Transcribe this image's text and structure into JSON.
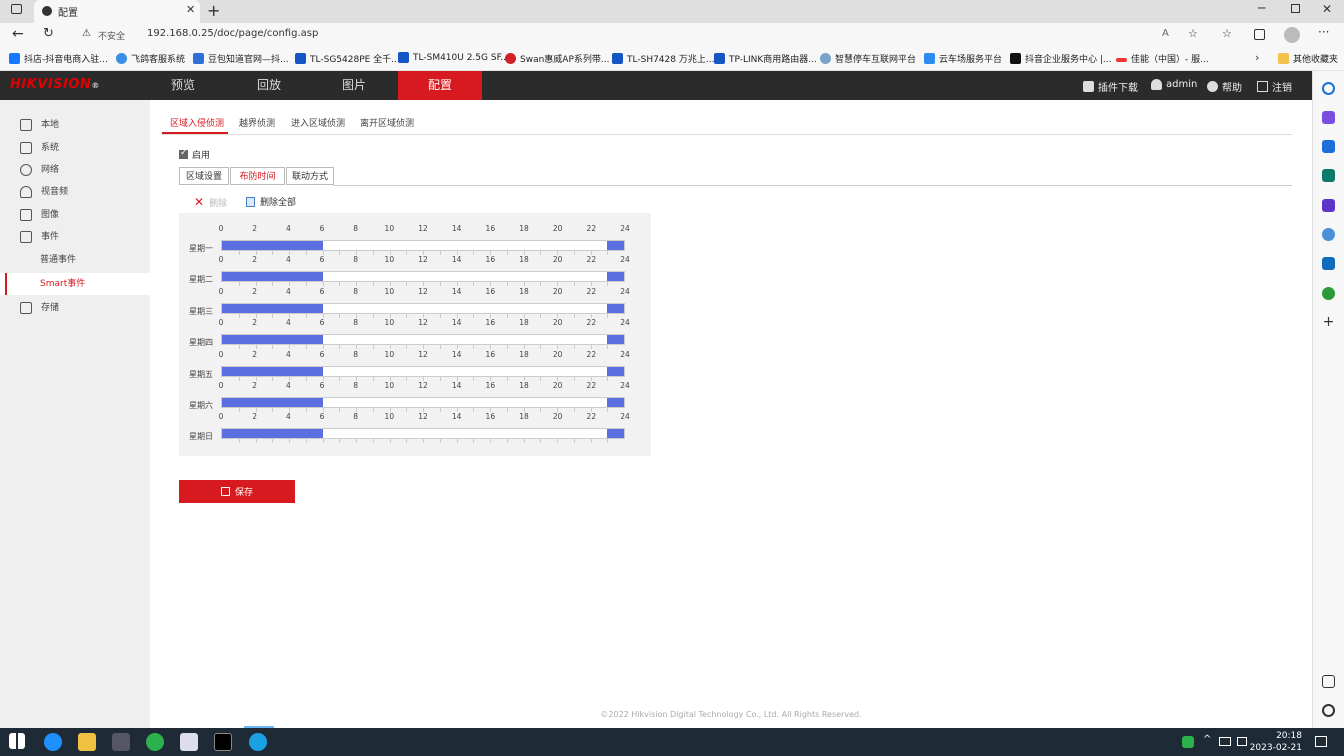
{
  "browser": {
    "tab_title": "配置",
    "security_label": "不安全",
    "url": "192.168.0.25/doc/page/config.asp",
    "bookmarks": [
      "抖店-抖音电商入驻...",
      "飞鸽客服系统",
      "豆包知道官网—抖...",
      "TL-SG5428PE 全千...",
      "TL-SM410U 2.5G SF...",
      "Swan惠威AP系列带...",
      "TL-SH7428 万兆上...",
      "TP-LINK商用路由器...",
      "智慧停车互联网平台",
      "云车场服务平台",
      "抖音企业服务中心 |...",
      "佳能（中国）- 服...",
      "其他收藏夹"
    ]
  },
  "header": {
    "brand": "HIKVISION",
    "nav": [
      "预览",
      "回放",
      "图片",
      "配置"
    ],
    "active_nav": "配置",
    "plugin_label": "插件下载",
    "user_label": "admin",
    "help_label": "帮助",
    "logout_label": "注销"
  },
  "sidebar": {
    "items": [
      {
        "label": "本地",
        "icon": "monitor-icon"
      },
      {
        "label": "系统",
        "icon": "system-icon"
      },
      {
        "label": "网络",
        "icon": "globe-icon"
      },
      {
        "label": "视音频",
        "icon": "mic-icon"
      },
      {
        "label": "图像",
        "icon": "image-icon"
      },
      {
        "label": "事件",
        "icon": "calendar-icon"
      },
      {
        "label": "普通事件",
        "icon": ""
      },
      {
        "label": "Smart事件",
        "icon": ""
      },
      {
        "label": "存储",
        "icon": "storage-icon"
      }
    ],
    "active_item": "Smart事件"
  },
  "main": {
    "tabs": [
      "区域入侵侦测",
      "越界侦测",
      "进入区域侦测",
      "离开区域侦测"
    ],
    "active_tab": "区域入侵侦测",
    "enable_label": "启用",
    "enabled": true,
    "step_tabs": [
      "区域设置",
      "布防时间",
      "联动方式"
    ],
    "active_step": "布防时间",
    "delete_label": "删除",
    "delete_all_label": "删除全部",
    "save_label": "保存",
    "schedule": {
      "ticks": [
        "0",
        "2",
        "4",
        "6",
        "8",
        "10",
        "12",
        "14",
        "16",
        "18",
        "20",
        "22",
        "24"
      ],
      "days": [
        {
          "day": "星期一",
          "segments": [
            [
              0,
              6
            ],
            [
              23,
              24
            ]
          ]
        },
        {
          "day": "星期二",
          "segments": [
            [
              0,
              6
            ],
            [
              23,
              24
            ]
          ]
        },
        {
          "day": "星期三",
          "segments": [
            [
              0,
              6
            ],
            [
              23,
              24
            ]
          ]
        },
        {
          "day": "星期四",
          "segments": [
            [
              0,
              6
            ],
            [
              23,
              24
            ]
          ]
        },
        {
          "day": "星期五",
          "segments": [
            [
              0,
              6
            ],
            [
              23,
              24
            ]
          ]
        },
        {
          "day": "星期六",
          "segments": [
            [
              0,
              6
            ],
            [
              23,
              24
            ]
          ]
        },
        {
          "day": "星期日",
          "segments": [
            [
              0,
              6
            ],
            [
              23,
              24
            ]
          ]
        }
      ]
    },
    "footer": "©2022 Hikvision Digital Technology Co., Ltd. All Rights Reserved."
  },
  "taskbar": {
    "time": "20:18",
    "date": "2023-02-21"
  },
  "colors": {
    "accent": "#d71920",
    "schedule_fill": "#5b6fe0",
    "header_bg": "#2b2b2b"
  }
}
